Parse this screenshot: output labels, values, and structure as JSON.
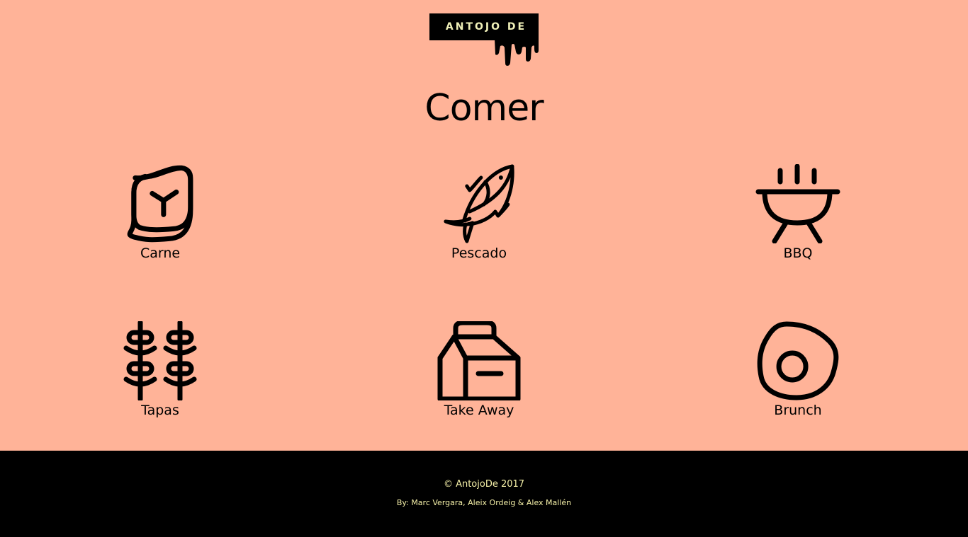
{
  "brand": {
    "logo_text": "ANTOJO DE",
    "logo_colors": {
      "bar": "#000000",
      "text": "#f0f0b8"
    }
  },
  "page": {
    "title": "Comer",
    "background": "#ffb398"
  },
  "categories": [
    {
      "label": "Carne",
      "icon": "steak-icon"
    },
    {
      "label": "Pescado",
      "icon": "fish-icon"
    },
    {
      "label": "BBQ",
      "icon": "grill-icon"
    },
    {
      "label": "Tapas",
      "icon": "skewers-icon"
    },
    {
      "label": "Take Away",
      "icon": "takeaway-box-icon"
    },
    {
      "label": "Brunch",
      "icon": "fried-egg-icon"
    }
  ],
  "footer": {
    "copyright": "© AntojoDe 2017",
    "credits": "By: Marc Vergara, Aleix Ordeig & Alex Mallén",
    "text_color": "#f5f0a8"
  }
}
